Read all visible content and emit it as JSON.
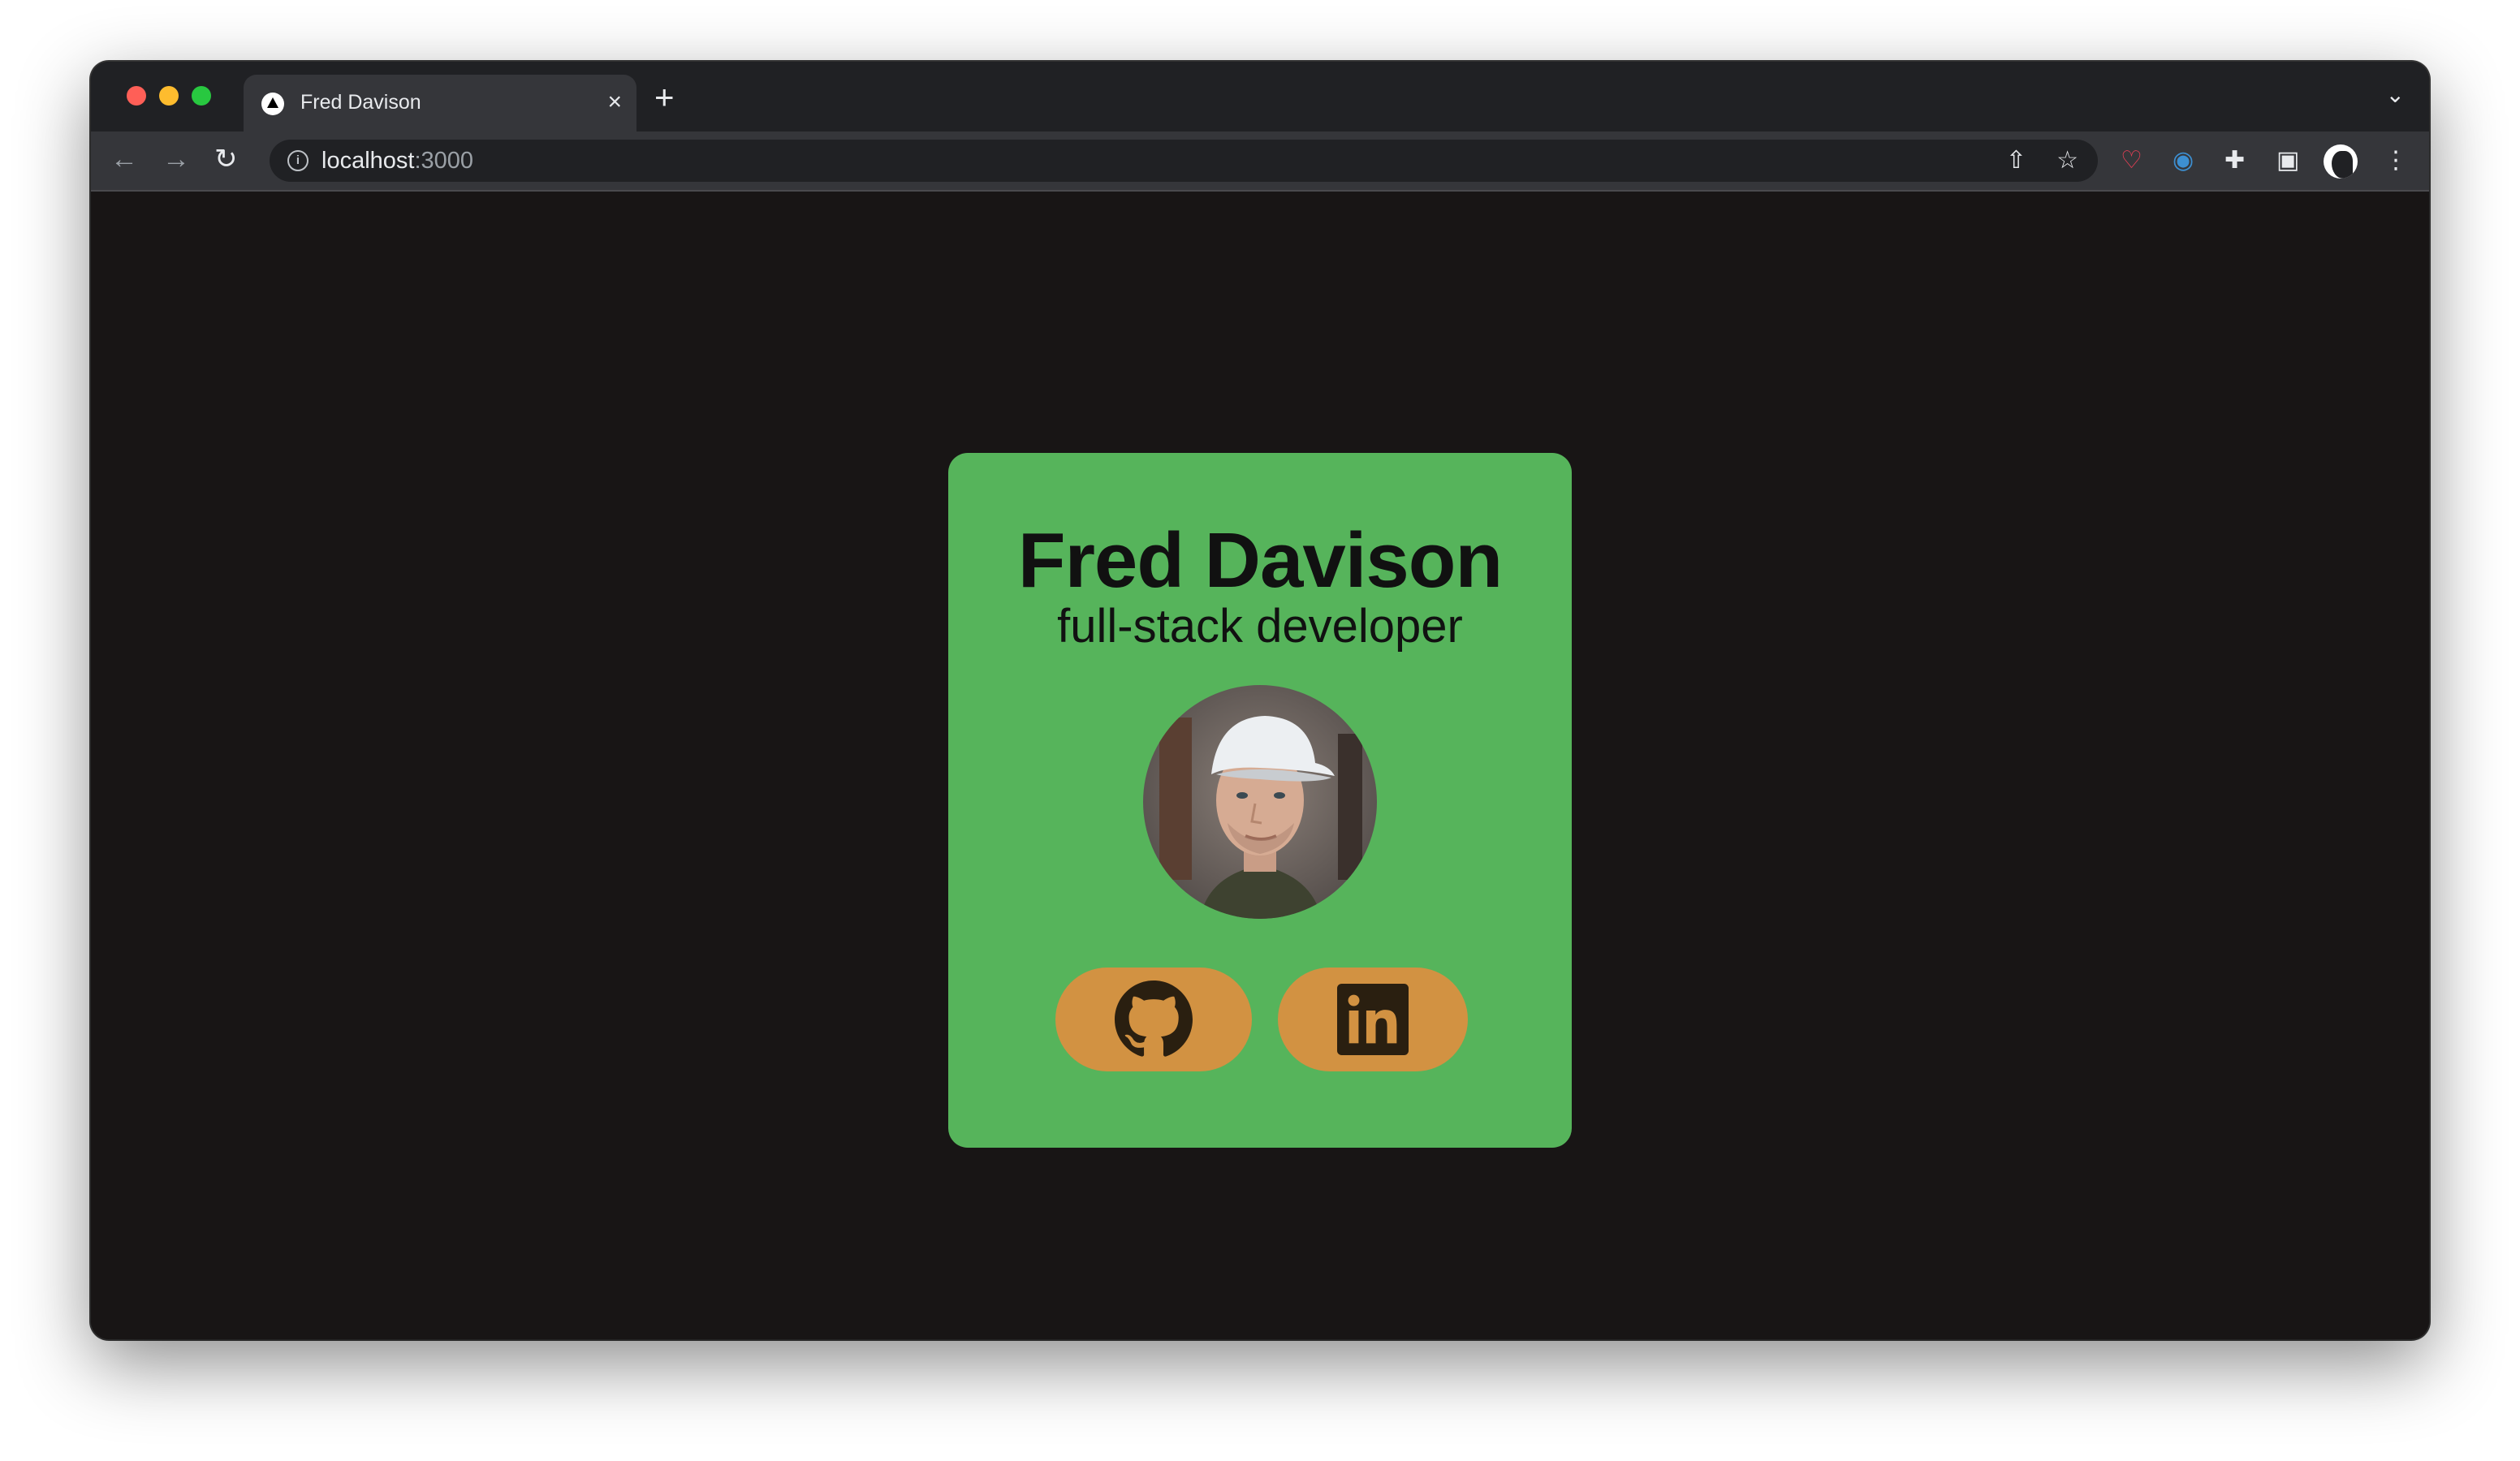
{
  "browser": {
    "tab_title": "Fred Davison",
    "tab_close": "×",
    "new_tab": "+",
    "tab_menu": "⌄",
    "url_host": "localhost",
    "url_port": ":3000",
    "icons": {
      "back": "arrow-left-icon",
      "forward": "arrow-right-icon",
      "reload": "reload-icon",
      "info": "info-icon",
      "share": "share-icon",
      "bookmark": "star-icon",
      "pocket": "pocket-icon",
      "extension": "circle-extension-icon",
      "extensions": "puzzle-icon",
      "side_panel": "side-panel-icon",
      "menu": "kebab-menu-icon"
    }
  },
  "card": {
    "name": "Fred Davison",
    "role": "full-stack developer",
    "colors": {
      "background": "#56b45b",
      "button": "#d29242",
      "page": "#181515"
    },
    "links": [
      {
        "icon": "github-icon"
      },
      {
        "icon": "linkedin-icon"
      }
    ]
  }
}
